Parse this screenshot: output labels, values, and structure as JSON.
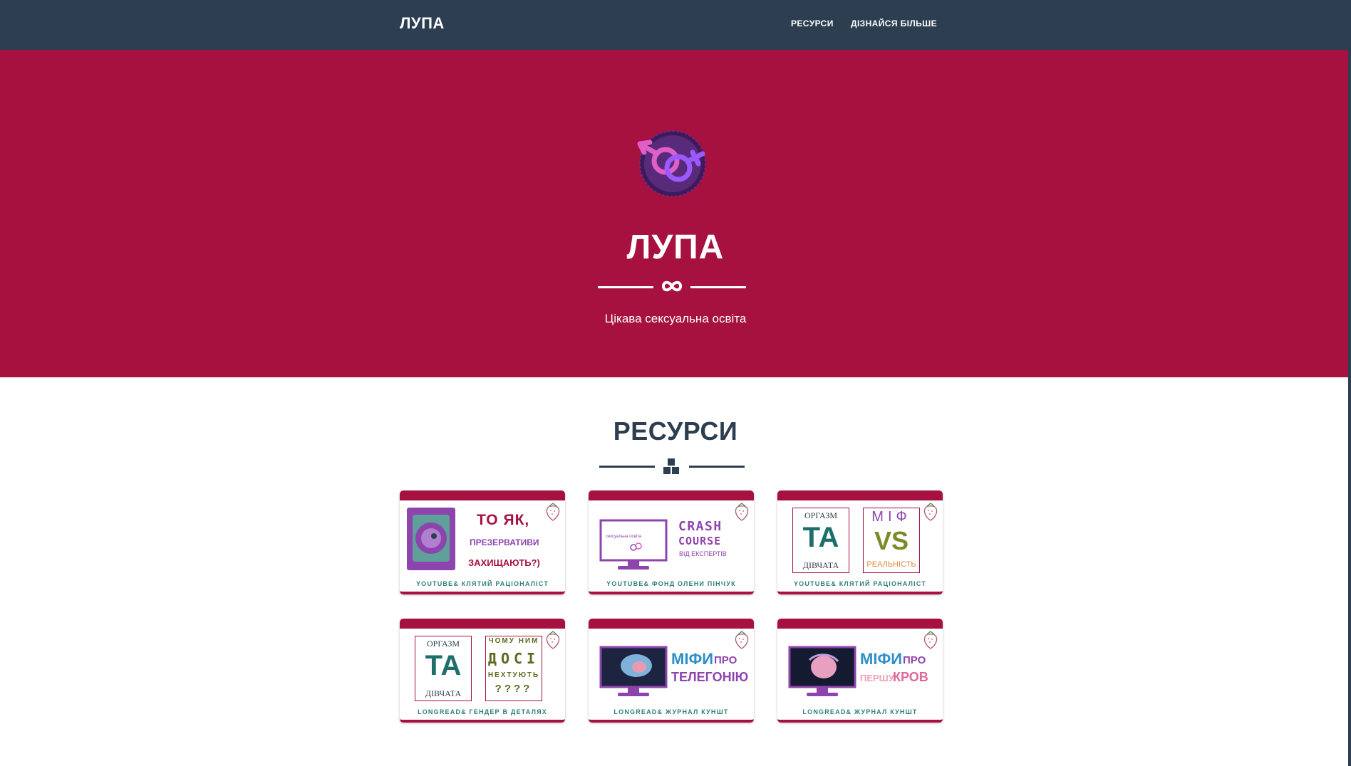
{
  "nav": {
    "brand": "ЛУПА",
    "links": [
      "РЕСУРСИ",
      "ДІЗНАЙСЯ БІЛЬШЕ"
    ]
  },
  "hero": {
    "title": "ЛУПА",
    "subtitle": "Цікава сексуальна освіта"
  },
  "resources": {
    "title": "РЕСУРСИ",
    "cards": [
      {
        "caption": "YOUTUBE& КЛЯТИЙ РАЦІОНАЛІСТ",
        "lines": [
          "ТО ЯК,",
          "ПРЕЗЕРВАТИВИ",
          "ЗАХИЩАЮТЬ?)"
        ]
      },
      {
        "caption": "YOUTUBE& ФОНД ОЛЕНИ ПІНЧУК",
        "lines": [
          "CRASH",
          "COURSE",
          "ВІД ЕКСПЕРТІВ",
          "сексуальна освіта"
        ]
      },
      {
        "caption": "YOUTUBE& КЛЯТИЙ РАЦІОНАЛІСТ",
        "lines": [
          "ОРГАЗМ",
          "ТА",
          "ДІВЧАТА",
          "МІФ",
          "VS",
          "РЕАЛЬНІСТЬ"
        ]
      },
      {
        "caption": "LONGREAD& ГЕНДЕР В ДЕТАЛЯХ",
        "lines": [
          "ОРГАЗМ",
          "ТА",
          "ДІВЧАТА",
          "ЧОМУ НИМ",
          "ДОСІ",
          "НЕХТУЮТЬ",
          "????"
        ]
      },
      {
        "caption": "LONGREAD& ЖУРНАЛ КУНШТ",
        "lines": [
          "МІФИ",
          "ПРО",
          "ТЕЛЕГОНІЮ"
        ]
      },
      {
        "caption": "LONGREAD& ЖУРНАЛ КУНШТ",
        "lines": [
          "МІФИ",
          "ПРО",
          "ПЕРШУ",
          "КРОВ"
        ]
      }
    ]
  },
  "colors": {
    "nav_bg": "#2c3e50",
    "hero_bg": "#a6113f",
    "accent_teal": "#2f7f7a",
    "purple": "#8e44ad"
  },
  "icons": {
    "hero_logo": "gender-symbols-logo-icon",
    "hero_divider": "infinity-icon",
    "section_divider": "boxes-icon",
    "card_badge": "strawberry-icon"
  }
}
